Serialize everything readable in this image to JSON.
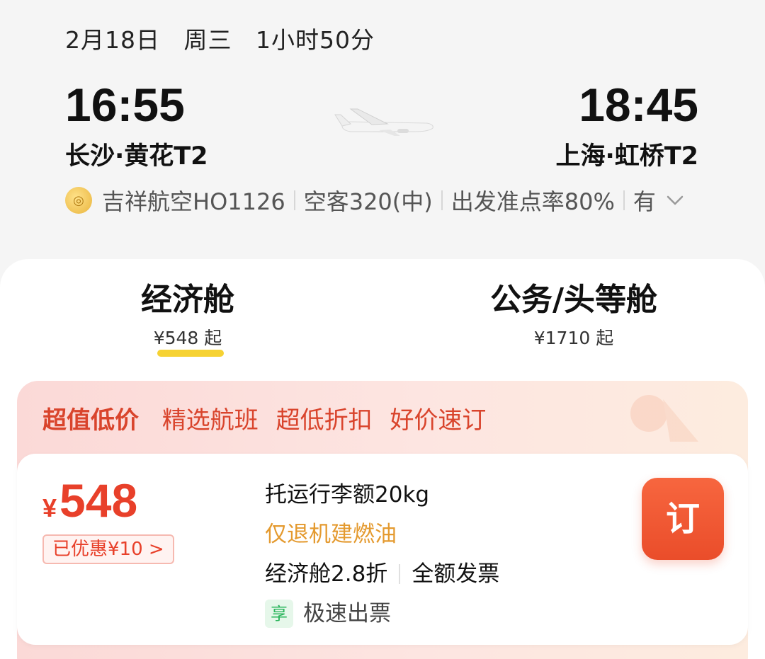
{
  "flight": {
    "date": "2月18日",
    "weekday": "周三",
    "duration": "1小时50分",
    "dep_time": "16:55",
    "arr_time": "18:45",
    "dep_airport": "长沙·黄花T2",
    "arr_airport": "上海·虹桥T2",
    "airline": "吉祥航空HO1126",
    "aircraft": "空客320(中)",
    "on_time": "出发准点率80%",
    "extra": "有"
  },
  "tabs": [
    {
      "title": "经济舱",
      "price": "¥548 起",
      "selected": true
    },
    {
      "title": "公务/头等舱",
      "price": "¥1710 起",
      "selected": false
    }
  ],
  "promo": {
    "headline": "超值低价",
    "items": [
      "精选航班",
      "超低折扣",
      "好价速订"
    ]
  },
  "fare": {
    "currency": "¥",
    "price": "548",
    "discount": "已优惠¥10 >",
    "baggage": "托运行李额20kg",
    "refund": "仅退机建燃油",
    "cabin": "经济舱2.8折",
    "invoice": "全额发票",
    "tag": "享",
    "speed": "极速出票",
    "book_label": "订"
  },
  "colors": {
    "accent": "#e8402a",
    "underline": "#f6d233",
    "refund_text": "#e49a2f",
    "book_button": "#ea4d2a"
  }
}
